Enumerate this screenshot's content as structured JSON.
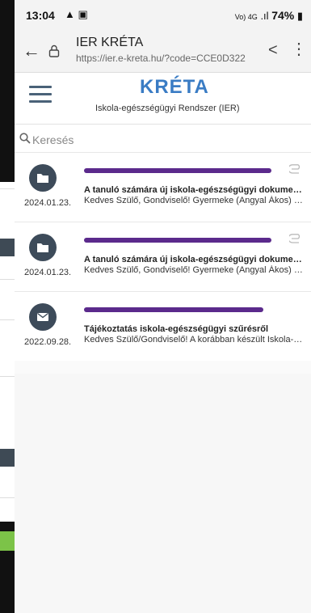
{
  "status_bar": {
    "time": "13:04",
    "network": "Vo) 4G",
    "battery": "74%"
  },
  "browser": {
    "title": "IER KRÉTA",
    "url": "https://ier.e-kreta.hu/?code=CCE0D322"
  },
  "app": {
    "logo": "KRÉTA",
    "subtitle": "Iskola-egészségügyi Rendszer (IER)",
    "search_placeholder": "Keresés"
  },
  "messages": [
    {
      "icon": "folder-icon",
      "date": "2024.01.23.",
      "subject": "A tanuló számára új iskola-egészségügyi dokumentum",
      "preview": "Kedves Szülő, Gondviselő! Gyermeke (Angyal Ákos) iskola-egészségügyi",
      "has_attachment": true
    },
    {
      "icon": "folder-icon",
      "date": "2024.01.23.",
      "subject": "A tanuló számára új iskola-egészségügyi dokumentum",
      "preview": "Kedves Szülő, Gondviselő! Gyermeke (Angyal Ákos) iskola-egészségügyi",
      "has_attachment": true
    },
    {
      "icon": "mail-icon",
      "date": "2022.09.28.",
      "subject": "Tájékoztatás iskola-egészségügyi szűrésről",
      "preview": "Kedves Szülő/Gondviselő! A korábban készült Iskola-egészségügyi",
      "has_attachment": false
    }
  ],
  "colors": {
    "brand": "#3a7cc4",
    "avatar": "#3d4b5a",
    "redaction": "#5b2a8c"
  }
}
